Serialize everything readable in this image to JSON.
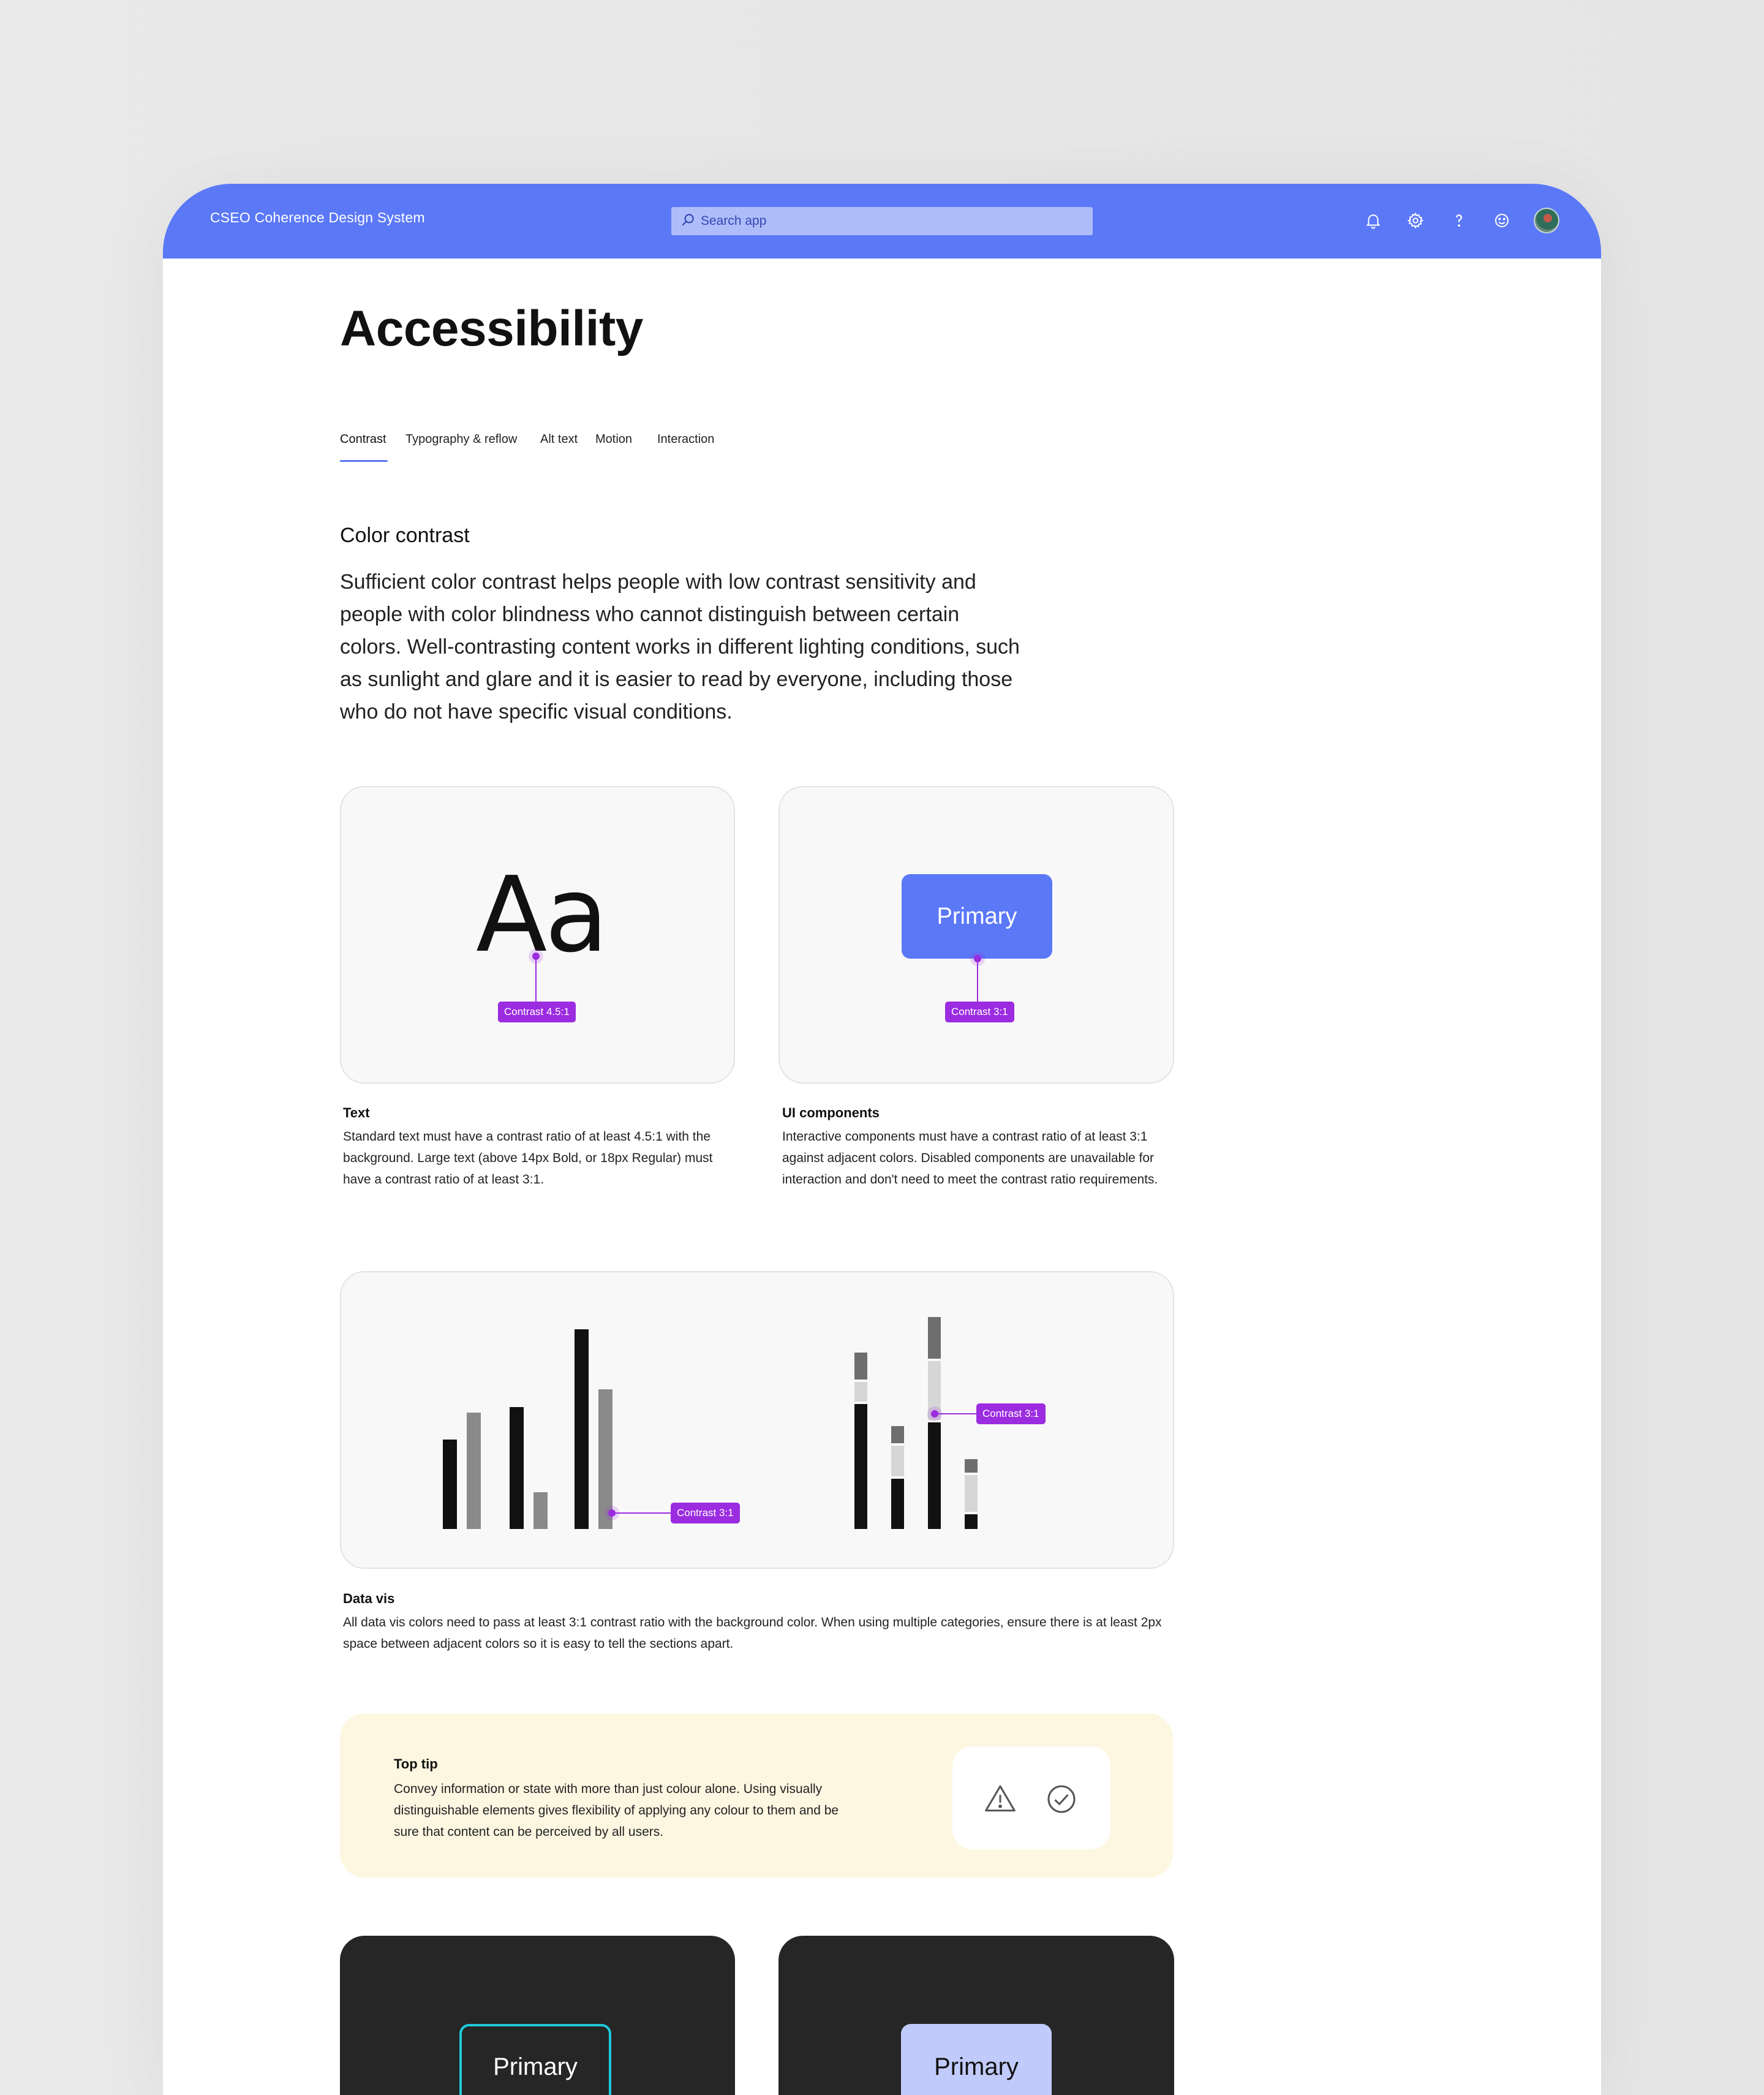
{
  "header": {
    "app_title": "CSEO Coherence Design System",
    "search_placeholder": "Search app",
    "icons": [
      "bell-icon",
      "gear-icon",
      "help-icon",
      "smiley-icon"
    ],
    "brand_color": "#5b78f7"
  },
  "page": {
    "title": "Accessibility",
    "tabs": [
      {
        "label": "Contrast",
        "active": true
      },
      {
        "label": "Typography & reflow",
        "active": false
      },
      {
        "label": "Alt text",
        "active": false
      },
      {
        "label": "Motion",
        "active": false
      },
      {
        "label": "Interaction",
        "active": false
      }
    ]
  },
  "section": {
    "title": "Color contrast",
    "body": "Sufficient color contrast helps people with low contrast sensitivity and people with color blindness who cannot distinguish between certain colors. Well-contrasting content works in different lighting conditions, such as sunlight and glare and it is easier to read by everyone, including those who do not have specific visual conditions."
  },
  "cards": {
    "text": {
      "sample": "Aa",
      "tag": "Contrast 4.5:1",
      "title": "Text",
      "body": "Standard text must have a contrast ratio of at least 4.5:1 with the background. Large text (above 14px Bold, or 18px Regular) must have a contrast ratio of at least 3:1."
    },
    "ui": {
      "button_label": "Primary",
      "tag": "Contrast 3:1",
      "title": "UI components",
      "body": "Interactive components must have a contrast ratio of at least 3:1 against adjacent colors.  Disabled components are unavailable for interaction and don't need to meet the contrast ratio requirements."
    },
    "datavis": {
      "tag_left": "Contrast 3:1",
      "tag_right": "Contrast 3:1",
      "title": "Data vis",
      "body": "All data vis colors need to pass at least 3:1 contrast ratio with the background color. When using multiple categories, ensure there is at least 2px space between adjacent colors so it is easy to tell the sections apart.",
      "colors": {
        "dark": "#111111",
        "mid": "#8a8a8a",
        "strong_gray": "#6e6e6e",
        "light": "#d6d6d6"
      }
    }
  },
  "tip": {
    "title": "Top tip",
    "body": "Convey information or state with more than just colour alone. Using visually distinguishable elements gives flexibility of applying any colour to them and be sure that content can be perceived by all users.",
    "icons": [
      "warning-icon",
      "check-circle-icon"
    ]
  },
  "dark_cards": {
    "left_button": "Primary",
    "right_button": "Primary",
    "outline_color": "#1fc9d9"
  }
}
